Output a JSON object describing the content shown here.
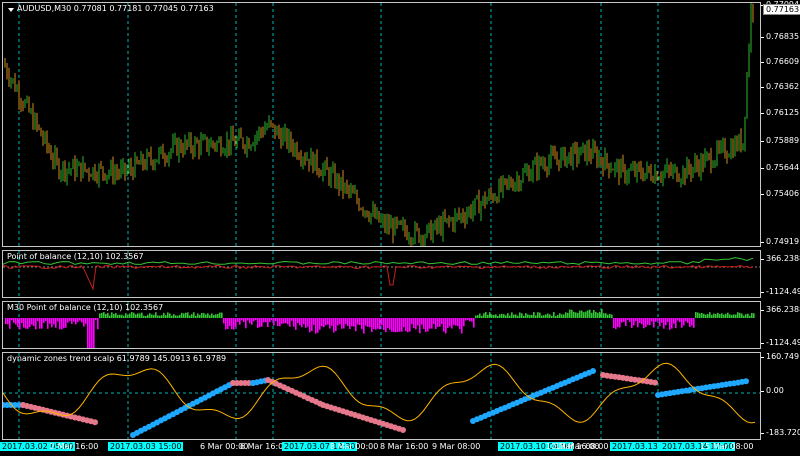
{
  "main": {
    "symbol_line": "AUDUSD,M30  0.77081 0.77181 0.77045 0.77163",
    "current_price": "0.77163",
    "y_ticks": [
      "0.77094",
      "0.76835",
      "0.76609",
      "0.76362",
      "0.76125",
      "0.75889",
      "0.75644",
      "0.75406",
      "0.74919"
    ]
  },
  "ind1": {
    "title": "Point of balance (12,10) 102.3567",
    "y_ticks": [
      "366.2388",
      "-1124.490"
    ]
  },
  "ind2": {
    "title": "M30 Point of balance (12,10) 102.3567",
    "y_ticks": [
      "366.2388",
      "-1124.490"
    ]
  },
  "ind3": {
    "title": "dynamic zones trend scalp 61.9789 145.0913 61.9789",
    "y_ticks": [
      "160.749",
      "0.00",
      "-183.7207"
    ]
  },
  "x_labels": [
    {
      "text": "2017.03.02 05:00",
      "hl": true
    },
    {
      "text": "2 Mar 16:00",
      "hl": false
    },
    {
      "text": "2017.03.03 15:00",
      "hl": true
    },
    {
      "text": "6 Mar 00:00",
      "hl": false
    },
    {
      "text": "6 Mar 16:00",
      "hl": false
    },
    {
      "text": "2017.03.07 12:30",
      "hl": true
    },
    {
      "text": "8 Mar 00:00",
      "hl": false
    },
    {
      "text": "8 Mar 16:00",
      "hl": false
    },
    {
      "text": "9 Mar 08:00",
      "hl": false
    },
    {
      "text": "2017.03.10 04:00",
      "hl": true
    },
    {
      "text": "10 Mar 16:00",
      "hl": false
    },
    {
      "text": "13 Mar 08:00",
      "hl": false
    },
    {
      "text": "2017.03.13 23:30",
      "hl": true
    },
    {
      "text": "2017.03.14 17:00",
      "hl": true
    },
    {
      "text": "15 Mar 08:00",
      "hl": false
    }
  ],
  "colors": {
    "bull": "#2db82d",
    "bear": "#d28c1e",
    "grid": "#00b4b4",
    "pob_line": "#c81e1e",
    "pob_green": "#35c535",
    "pob_magenta": "#ff00ff",
    "zone_up": "#1ea8ff",
    "zone_down": "#e6788c",
    "zone_line": "#ffb400"
  },
  "chart_data": {
    "type": "line",
    "title": "AUDUSD,M30",
    "xlabel": "",
    "ylabel": "",
    "ylim": [
      0.7488,
      0.7722
    ],
    "x": [
      "2 Mar 05:00",
      "2 Mar 16:00",
      "3 Mar 15:00",
      "6 Mar 00:00",
      "6 Mar 16:00",
      "7 Mar 12:30",
      "8 Mar 00:00",
      "8 Mar 16:00",
      "9 Mar 08:00",
      "10 Mar 04:00",
      "10 Mar 16:00",
      "13 Mar 08:00",
      "13 Mar 23:30",
      "14 Mar 17:00",
      "15 Mar 08:00",
      "15 Mar 20:00"
    ],
    "series": [
      {
        "values": [
          0.7665,
          0.7565,
          0.756,
          0.7585,
          0.759,
          0.7605,
          0.7555,
          0.751,
          0.75,
          0.752,
          0.757,
          0.758,
          0.756,
          0.756,
          0.759,
          0.7716
        ]
      }
    ]
  }
}
